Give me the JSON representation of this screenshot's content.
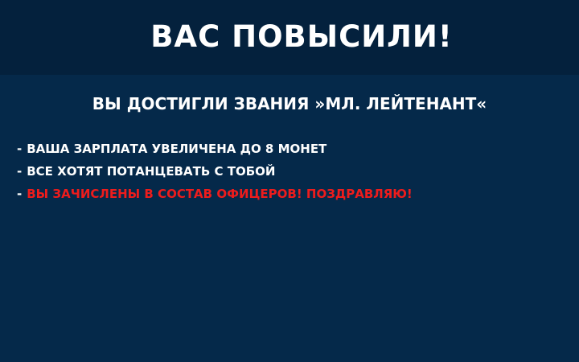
{
  "header": {
    "title": "ВАС ПОВЫСИЛИ!"
  },
  "rank": {
    "text": "ВЫ ДОСТИГЛИ ЗВАНИЯ »МЛ. ЛЕЙТЕНАНТ«"
  },
  "details": [
    {
      "prefix": "-",
      "text": "ВАША ЗАРПЛАТА УВЕЛИЧЕНА ДО 8 МОНЕТ"
    },
    {
      "prefix": "-",
      "text": "ВСЕ ХОТЯТ ПОТАНЦЕВАТЬ С ТОБОЙ"
    },
    {
      "prefix": "-",
      "text": "ВЫ ЗАЧИСЛЕНЫ В СОСТАВ ОФИЦЕРОВ! ПОЗДРАВЛЯЮ!"
    }
  ],
  "colors": {
    "header_bg": "#04213d",
    "body_bg": "#05294a",
    "text": "#ffffff",
    "highlight": "#ee1c1c"
  }
}
